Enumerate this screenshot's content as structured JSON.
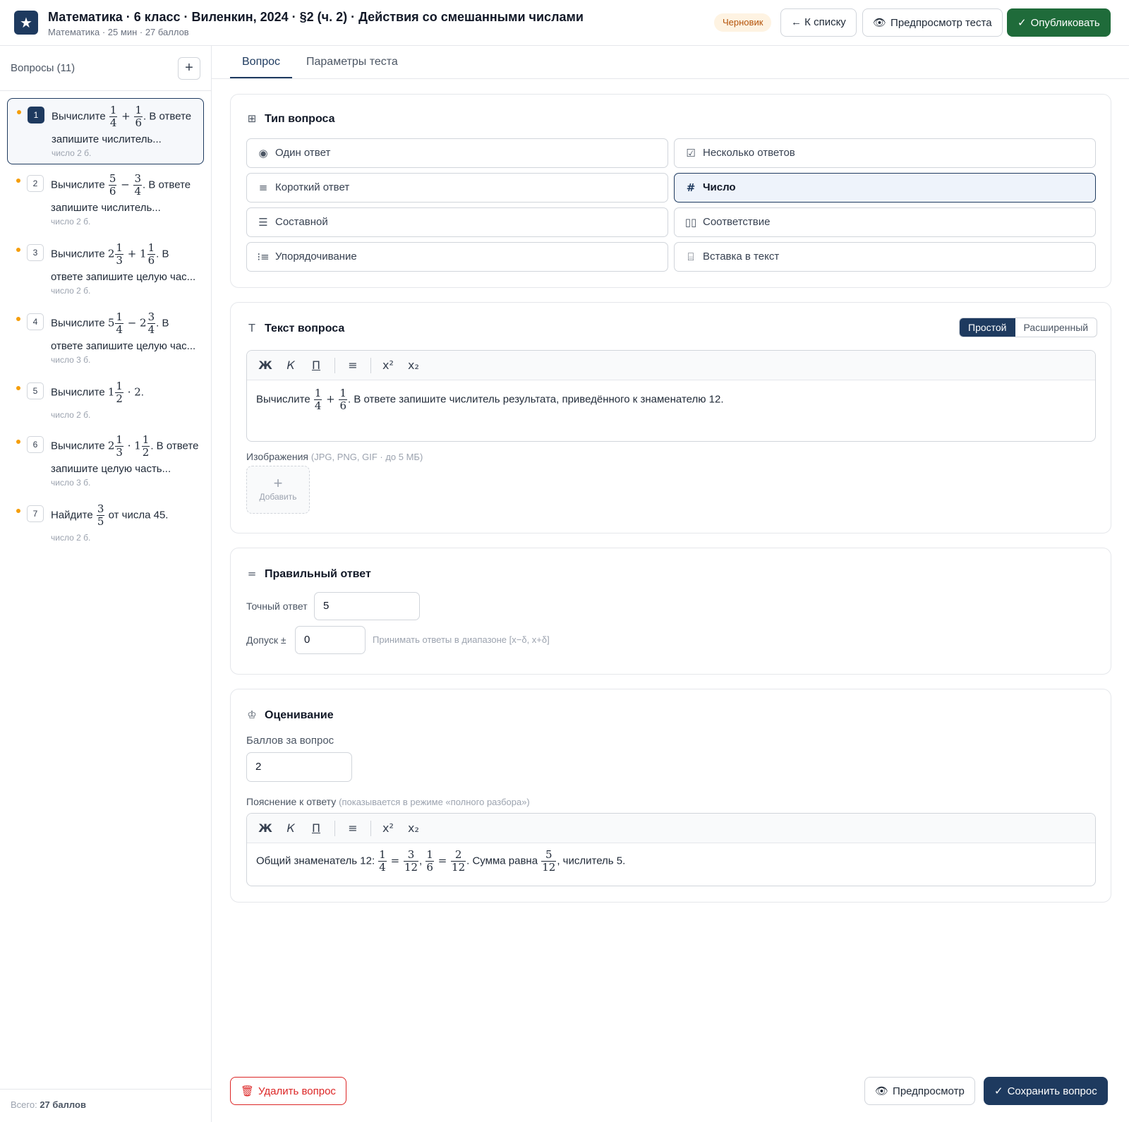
{
  "header": {
    "title": "Математика · 6 класс · Виленкин, 2024 · §2 (ч. 2) · Действия со смешанными числами",
    "subtitle": "Математика · 25 мин · 27 баллов",
    "status": "Черновик",
    "back_label": "← К списку",
    "preview_label": "Предпросмотр теста",
    "publish_label": "Опубликовать"
  },
  "sidebar": {
    "heading": "Вопросы (11)",
    "add": "+",
    "items": [
      {
        "num": "1",
        "pre": "Вычислите",
        "post": ". В ответе",
        "line2": "запишите числитель...",
        "meta": "число  2 б."
      },
      {
        "num": "2",
        "pre": "Вычислите",
        "post": ". В ответе",
        "line2": "запишите числитель...",
        "meta": "число  2 б."
      },
      {
        "num": "3",
        "pre": "Вычислите",
        "post": ". В",
        "line2": "ответе запишите целую час...",
        "meta": "число  2 б."
      },
      {
        "num": "4",
        "pre": "Вычислите",
        "post": ". В",
        "line2": "ответе запишите целую час...",
        "meta": "число  3 б."
      },
      {
        "num": "5",
        "pre": "Вычислите",
        "post": ".",
        "line2": "",
        "meta": "число  2 б."
      },
      {
        "num": "6",
        "pre": "Вычислите",
        "post": ". В ответе",
        "line2": "запишите целую часть...",
        "meta": "число  3 б."
      },
      {
        "num": "7",
        "pre": "Найдите",
        "post": " от числа 45.",
        "line2": "",
        "meta": "число  2 б."
      }
    ],
    "total_label": "Всего:",
    "total_value": "27 баллов"
  },
  "tabs": [
    "Вопрос",
    "Параметры теста"
  ],
  "question_type": {
    "title": "Тип вопроса",
    "options": [
      {
        "label": "Один ответ",
        "icon": "radio-icon"
      },
      {
        "label": "Несколько ответов",
        "icon": "checkbox-icon"
      },
      {
        "label": "Короткий ответ",
        "icon": "lines-icon"
      },
      {
        "label": "Число",
        "icon": "hash-icon"
      },
      {
        "label": "Составной",
        "icon": "list-icon"
      },
      {
        "label": "Соответствие",
        "icon": "columns-icon"
      },
      {
        "label": "Упорядочивание",
        "icon": "ordered-list-icon"
      },
      {
        "label": "Вставка в текст",
        "icon": "text-insert-icon"
      }
    ],
    "selected": "Число"
  },
  "question_text": {
    "title": "Текст вопроса",
    "mode_simple": "Простой",
    "mode_advanced": "Расширенный",
    "toolbar": [
      "Ж",
      "К",
      "П",
      "≡",
      "x²",
      "x₂"
    ],
    "text_pre": "Вычислите",
    "text_post": ". В ответе запишите числитель результата, приведённого к знаменателю 12.",
    "images_label": "Изображения",
    "images_hint": "(JPG, PNG, GIF · до 5 МБ)",
    "add_image": "Добавить"
  },
  "answer": {
    "title": "Правильный ответ",
    "exact_label": "Точный ответ",
    "exact_value": "5",
    "tolerance_label": "Допуск ±",
    "tolerance_value": "0",
    "tolerance_hint": "Принимать ответы в диапазоне [x−δ, x+δ]"
  },
  "grading": {
    "title": "Оценивание",
    "points_label": "Баллов за вопрос",
    "points_value": "2",
    "explanation_label": "Пояснение к ответу",
    "explanation_hint": "(показывается в режиме «полного разбора»)",
    "explanation_pre": "Общий знаменатель 12:",
    "explanation_mid": ". Сумма равна",
    "explanation_post": ", числитель 5."
  },
  "footer": {
    "delete_label": "Удалить вопрос",
    "preview_label": "Предпросмотр",
    "save_label": "Сохранить вопрос"
  },
  "colors": {
    "primary": "#1e3a5f",
    "publish": "#1f6b3a",
    "danger": "#dc2626",
    "draft": "#b45309"
  }
}
